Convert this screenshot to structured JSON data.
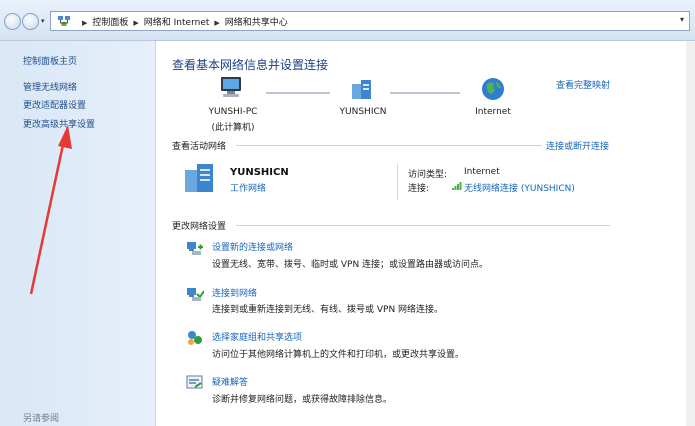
{
  "address_bar": {
    "crumbs": [
      "控制面板",
      "网络和 Internet",
      "网络和共享中心"
    ]
  },
  "left_pane": {
    "home": "控制面板主页",
    "links": [
      "管理无线网络",
      "更改适配器设置",
      "更改高级共享设置"
    ],
    "see_also": "另请参阅"
  },
  "main": {
    "title": "查看基本网络信息并设置连接",
    "full_map_link": "查看完整映射",
    "map_nodes": [
      {
        "label_1": "YUNSHI-PC",
        "label_2": "(此计算机)",
        "icon": "computer-icon"
      },
      {
        "label_1": "YUNSHICN",
        "icon": "network-icon"
      },
      {
        "label_1": "Internet",
        "icon": "globe-icon"
      }
    ],
    "active_section": {
      "heading": "查看活动网络",
      "link": "连接或断开连接",
      "network_name": "YUNSHICN",
      "network_type": "工作网络",
      "access_type_label": "访问类型:",
      "access_type_value": "Internet",
      "connection_label": "连接:",
      "connection_value": "无线网络连接 (YUNSHICN)"
    },
    "change_section": {
      "heading": "更改网络设置",
      "tasks": [
        {
          "title": "设置新的连接或网络",
          "desc": "设置无线、宽带、拨号、临时或 VPN 连接；或设置路由器或访问点。",
          "icon": "new-connection-icon"
        },
        {
          "title": "连接到网络",
          "desc": "连接到或重新连接到无线、有线、拨号或 VPN 网络连接。",
          "icon": "connect-network-icon"
        },
        {
          "title": "选择家庭组和共享选项",
          "desc": "访问位于其他网络计算机上的文件和打印机，或更改共享设置。",
          "icon": "homegroup-icon"
        },
        {
          "title": "疑难解答",
          "desc": "诊断并修复网络问题，或获得故障排除信息。",
          "icon": "troubleshoot-icon"
        }
      ]
    }
  },
  "annotation": {
    "color": "#e53935"
  }
}
